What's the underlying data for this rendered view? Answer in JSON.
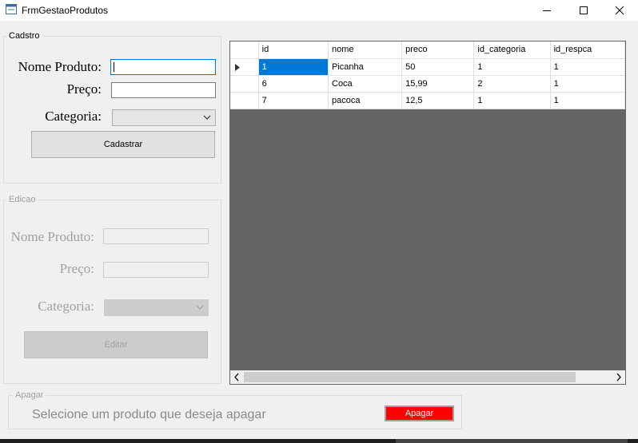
{
  "window": {
    "title": "FrmGestaoProdutos",
    "controls": [
      "minimize-icon",
      "maximize-icon",
      "close-icon"
    ]
  },
  "cadastro": {
    "legend": "Cadstro",
    "nome_label": "Nome Produto:",
    "nome_value": "",
    "preco_label": "Preço:",
    "preco_value": "",
    "categoria_label": "Categoria:",
    "categoria_value": "",
    "button_label": "Cadastrar"
  },
  "edicao": {
    "legend": "Edicao",
    "nome_label": "Nome Produto:",
    "nome_value": "",
    "preco_label": "Preço:",
    "preco_value": "",
    "categoria_label": "Categoria:",
    "categoria_value": "",
    "button_label": "Editar"
  },
  "grid": {
    "columns": [
      "id",
      "nome",
      "preco",
      "id_categoria",
      "id_respca"
    ],
    "rows": [
      [
        "1",
        "Picanha",
        "50",
        "1",
        "1"
      ],
      [
        "6",
        "Coca",
        "15,99",
        "2",
        "1"
      ],
      [
        "7",
        "pacoca",
        "12,5",
        "1",
        "1"
      ]
    ],
    "selected_row": 0,
    "colors": {
      "selection": "#0078d7",
      "background": "#646464"
    }
  },
  "apagar": {
    "legend": "Apagar",
    "hint": "Selecione um produto que deseja apagar",
    "button_label": "Apagar",
    "button_color": "#ff0000"
  }
}
